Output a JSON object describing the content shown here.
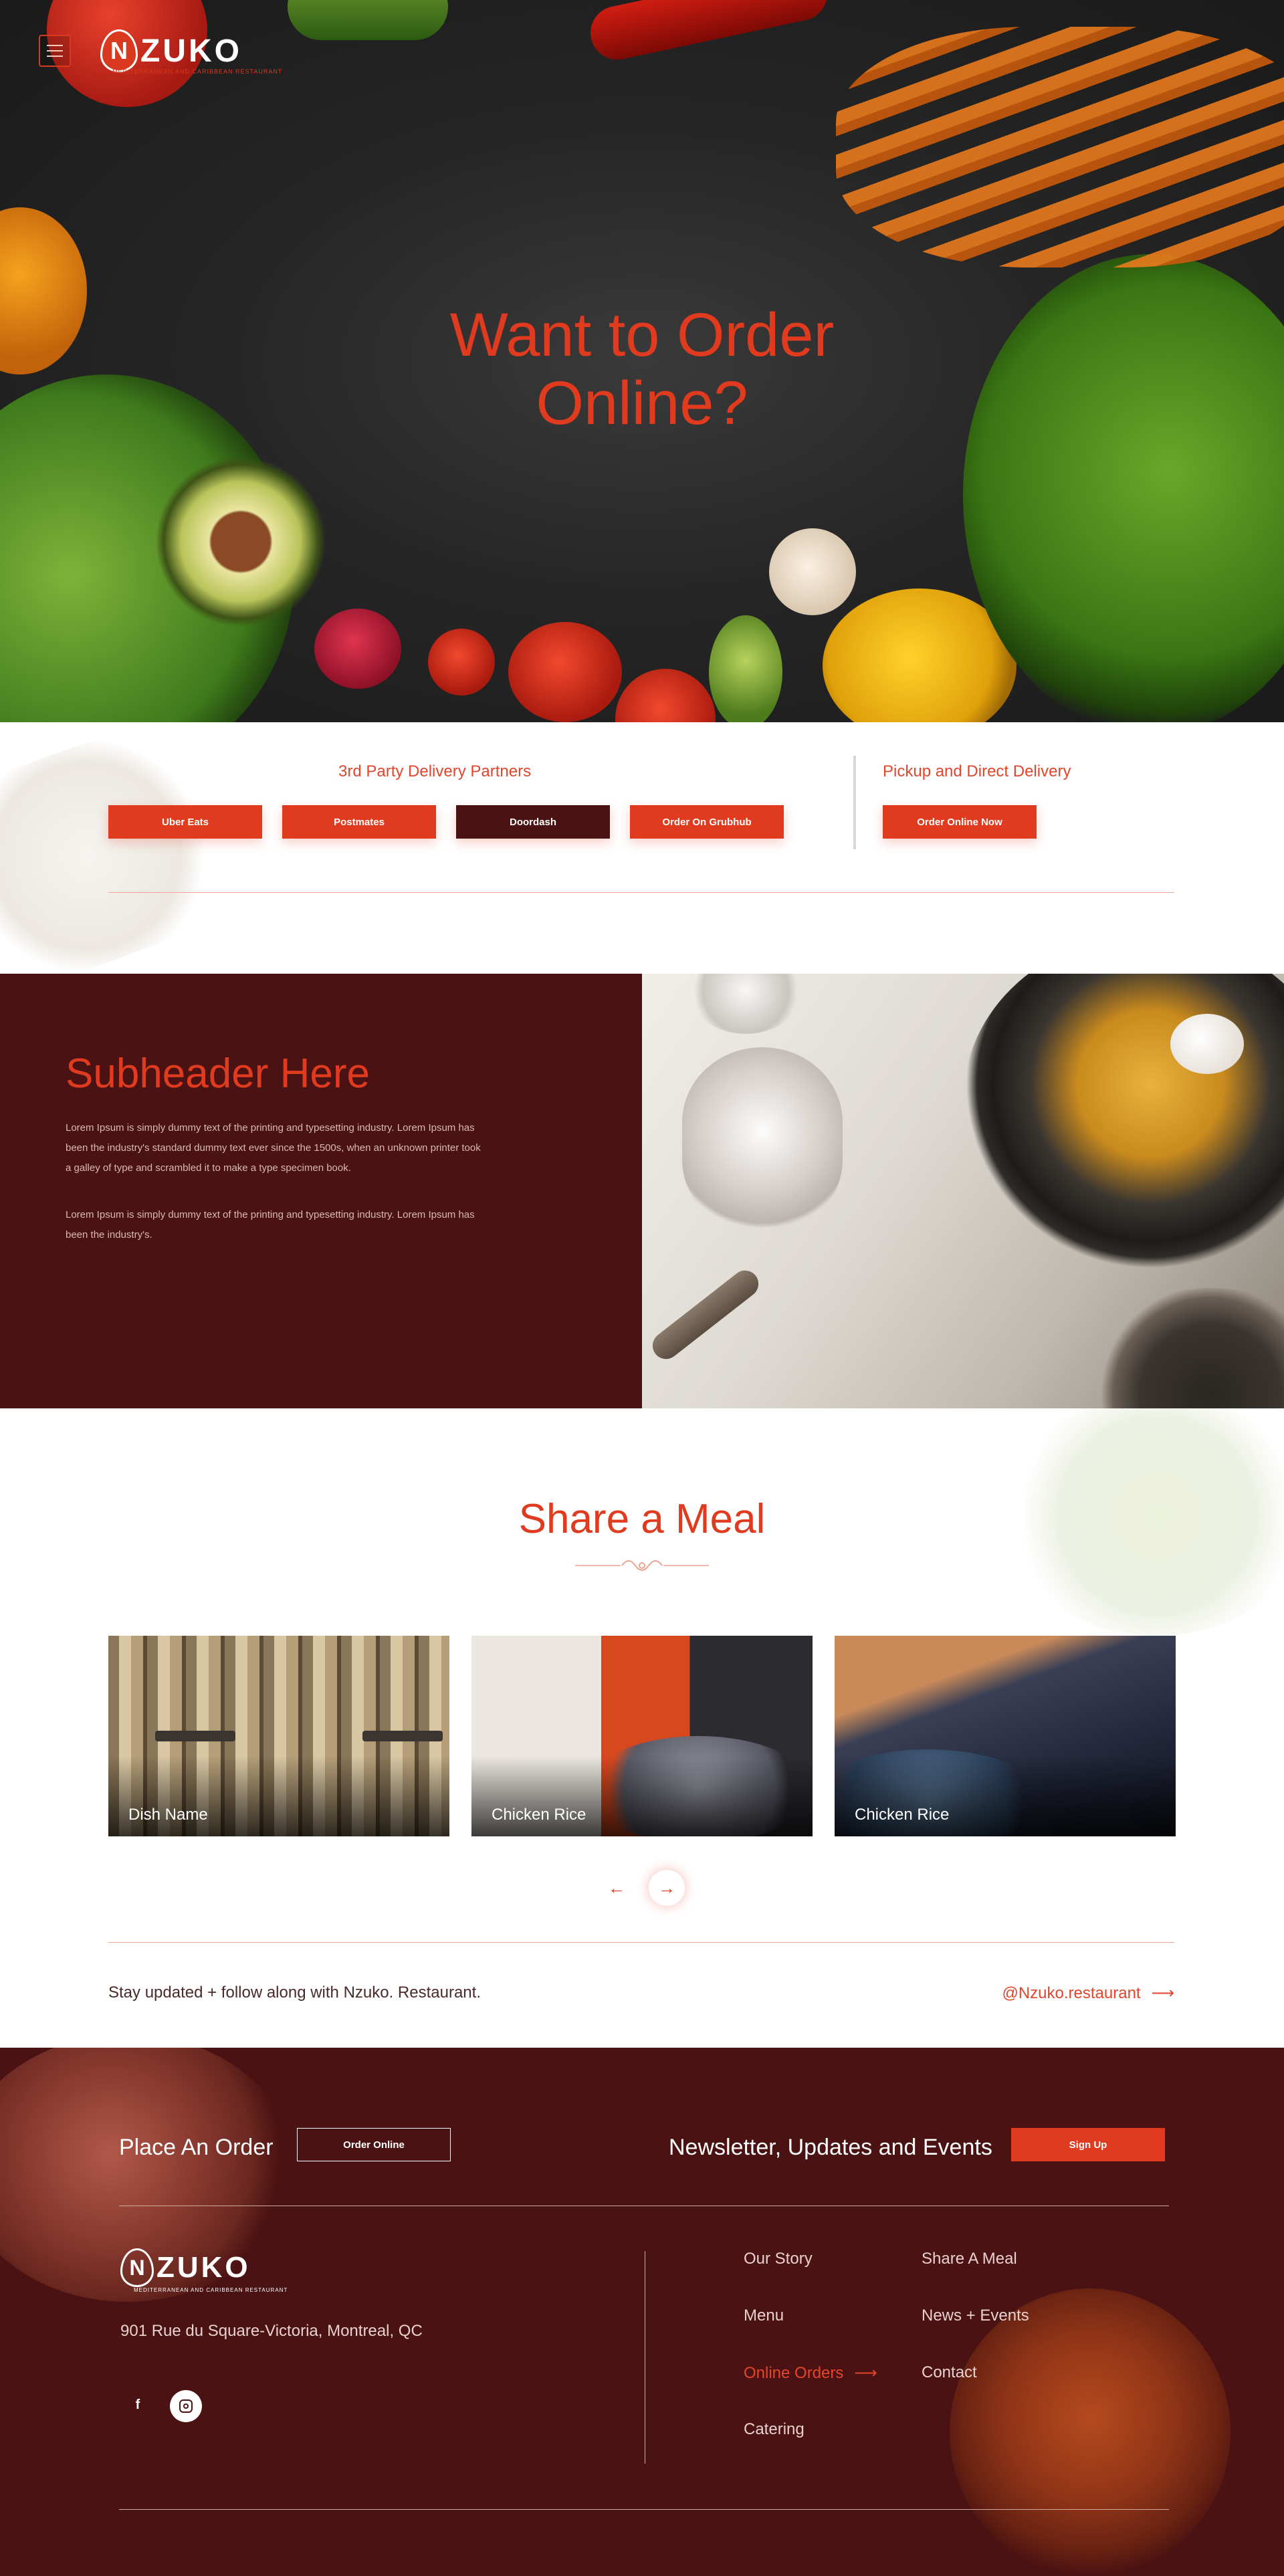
{
  "brand": {
    "name": "NZUKO",
    "initial": "N",
    "word": "ZUKO",
    "tagline": "MEDITERRANEAN AND CARIBBEAN RESTAURANT"
  },
  "icons": {
    "menu": "hamburger-icon",
    "prev": "arrow-left-icon",
    "next": "arrow-right-icon",
    "handle_arrow": "arrow-right-icon",
    "facebook": "facebook-icon",
    "instagram": "instagram-icon",
    "ornament": "flourish-ornament"
  },
  "colors": {
    "accent": "#e03a1f",
    "dark": "#4a1212",
    "white": "#ffffff"
  },
  "hero": {
    "title_line1": "Want to Order",
    "title_line2": "Online?"
  },
  "delivery": {
    "third_party_label": "3rd Party Delivery Partners",
    "partners": [
      "Uber Eats",
      "Postmates",
      "Doordash",
      "Order On Grubhub"
    ],
    "direct_label": "Pickup and Direct Delivery",
    "direct_button": "Order Online Now"
  },
  "about": {
    "title": "Subheader Here",
    "p1": "Lorem Ipsum is simply dummy text of the printing and typesetting industry. Lorem Ipsum has been the industry's standard dummy text ever since the 1500s, when an unknown printer took a galley of type and scrambled it to make a type specimen book.",
    "p2": "Lorem Ipsum is simply dummy text of the printing and typesetting industry. Lorem Ipsum has been the industry's."
  },
  "meal": {
    "title": "Share a Meal",
    "cards": [
      "Dish Name",
      "Chicken Rice",
      "Chicken Rice"
    ],
    "prev": "←",
    "next": "→",
    "follow_text": "Stay updated + follow along with Nzuko. Restaurant.",
    "handle": "@Nzuko.restaurant",
    "handle_arrow": "⟶"
  },
  "footer": {
    "place_order": "Place An Order",
    "order_online": "Order Online",
    "newsletter": "Newsletter, Updates and Events",
    "signup": "Sign Up",
    "address": "901 Rue du Square-Victoria, Montreal, QC",
    "facebook": "f",
    "links": {
      "our_story": "Our Story",
      "share_a_meal": "Share A Meal",
      "menu": "Menu",
      "news_events": "News + Events",
      "online_orders": "Online Orders",
      "contact": "Contact",
      "catering": "Catering"
    },
    "active_arrow": "⟶"
  }
}
